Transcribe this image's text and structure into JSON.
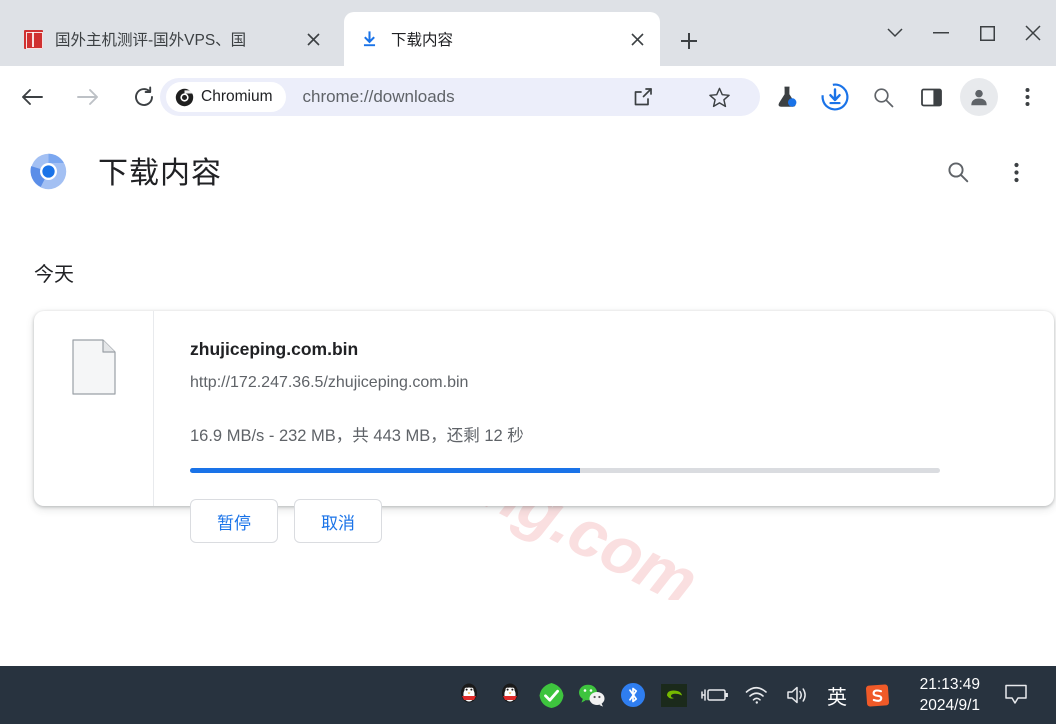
{
  "browser": {
    "name": "Chromium",
    "tabs": [
      {
        "title": "国外主机测评-国外VPS、国",
        "favicon": "red-seal-icon",
        "active": false,
        "close_label": "×"
      },
      {
        "title": "下载内容",
        "favicon": "download-arrow-icon",
        "active": true,
        "close_label": "×"
      }
    ],
    "new_tab_label": "+",
    "window_controls": {
      "tab_search": "tab-search-chevron-icon",
      "minimize": "minimize-icon",
      "maximize": "maximize-icon",
      "close": "close-icon"
    },
    "toolbar": {
      "back": "back-arrow-icon",
      "forward": "forward-arrow-icon",
      "reload": "reload-icon",
      "chip_label": "Chromium",
      "url": "chrome://downloads",
      "share": "share-icon",
      "bookmark": "star-icon",
      "experiments": "flask-icon",
      "downloads": "download-circle-icon",
      "search": "search-icon",
      "side_panel": "side-panel-icon",
      "profile": "profile-avatar-icon",
      "menu": "three-dot-menu-icon"
    }
  },
  "downloads_page": {
    "logo": "chromium-logo",
    "title": "下载内容",
    "search_icon": "search-icon",
    "menu_icon": "three-dot-menu-icon",
    "section_date": "今天",
    "watermark": "zhujiceping.com",
    "items": [
      {
        "file_icon": "generic-file-icon",
        "filename": "zhujiceping.com.bin",
        "url": "http://172.247.36.5/zhujiceping.com.bin",
        "status": "16.9 MB/s - 232 MB，共 443 MB，还剩 12 秒",
        "speed": "16.9 MB/s",
        "downloaded": "232 MB",
        "total": "443 MB",
        "time_remaining": "12 秒",
        "progress_percent": 52,
        "progress_color": "#1a73e8",
        "pause_label": "暂停",
        "cancel_label": "取消"
      }
    ]
  },
  "taskbar": {
    "tray_icons": [
      "qq-penguin-icon",
      "qq-penguin-icon",
      "green-check-shield-icon",
      "wechat-icon",
      "bluetooth-icon",
      "nvidia-icon",
      "battery-charging-icon",
      "wifi-icon",
      "volume-icon",
      "ime-english-icon",
      "sogou-input-icon"
    ],
    "ime_label": "英",
    "sogou_label": "S",
    "time": "21:13:49",
    "date": "2024/9/1",
    "notification": "notification-bubble-icon"
  },
  "colors": {
    "accent_blue": "#1a73e8",
    "tabstrip_bg": "#dee1e6",
    "omnibox_bg": "#eceefa",
    "taskbar_bg": "#28333f",
    "watermark_pink": "#fadfe0"
  }
}
